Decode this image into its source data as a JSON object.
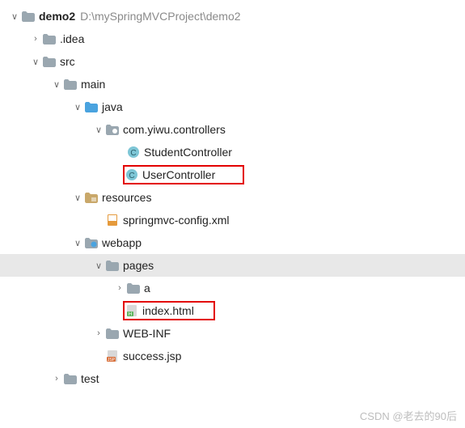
{
  "root": {
    "name": "demo2",
    "path": "D:\\mySpringMVCProject\\demo2"
  },
  "nodes": {
    "idea": ".idea",
    "src": "src",
    "main": "main",
    "java": "java",
    "pkg": "com.yiwu.controllers",
    "studentCtrl": "StudentController",
    "userCtrl": "UserController",
    "resources": "resources",
    "springConfig": "springmvc-config.xml",
    "webapp": "webapp",
    "pages": "pages",
    "a": "a",
    "indexHtml": "index.html",
    "webinf": "WEB-INF",
    "successJsp": "success.jsp",
    "test": "test"
  },
  "watermark": "CSDN @老去的90后"
}
